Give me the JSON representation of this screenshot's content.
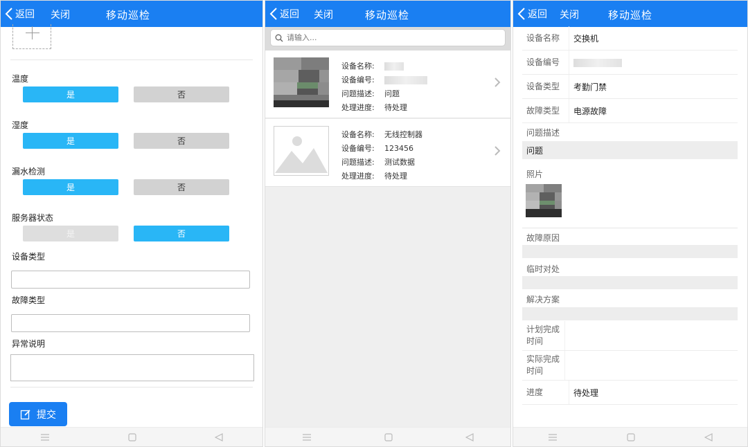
{
  "header": {
    "back_label": "返回",
    "close_label": "关闭",
    "title": "移动巡检"
  },
  "form": {
    "groups": [
      {
        "label": "温度",
        "yes": "是",
        "no": "否",
        "selected": "yes"
      },
      {
        "label": "湿度",
        "yes": "是",
        "no": "否",
        "selected": "yes"
      },
      {
        "label": "漏水检测",
        "yes": "是",
        "no": "否",
        "selected": "yes"
      },
      {
        "label": "服务器状态",
        "yes": "是",
        "no": "否",
        "selected": "no"
      }
    ],
    "device_type_label": "设备类型",
    "device_type_value": "",
    "fault_type_label": "故障类型",
    "fault_type_value": "",
    "exception_label": "异常说明",
    "exception_value": "",
    "submit_label": "提交"
  },
  "list": {
    "search_placeholder": "请输入...",
    "keys": {
      "name": "设备名称:",
      "code": "设备编号:",
      "desc": "问题描述:",
      "progress": "处理进度:"
    },
    "items": [
      {
        "name": "",
        "code": "",
        "desc": "问题",
        "progress": "待处理",
        "image": "pixelated-photo"
      },
      {
        "name": "无线控制器",
        "code": "123456",
        "desc": "测试数据",
        "progress": "待处理",
        "image": "placeholder-image-icon"
      }
    ]
  },
  "detail": {
    "device_name_label": "设备名称",
    "device_name": "交换机",
    "device_code_label": "设备编号",
    "device_code": "",
    "device_type_label": "设备类型",
    "device_type": "考勤门禁",
    "fault_type_label": "故障类型",
    "fault_type": "电源故障",
    "problem_label": "问题描述",
    "problem": "问题",
    "photo_label": "照片",
    "cause_label": "故障原因",
    "cause": "",
    "temp_label": "临时对处",
    "temp": "",
    "solution_label": "解决方案",
    "solution": "",
    "planned_label": "计划完成时间",
    "planned": "",
    "actual_label": "实际完成时间",
    "actual": "",
    "progress_label": "进度",
    "progress": "待处理"
  },
  "colors": {
    "header": "#1a7ff2",
    "selected": "#29b6f6",
    "unselected": "#d2d2d2"
  },
  "icons": {
    "back": "chevron-left-icon",
    "search": "search-icon",
    "edit": "edit-icon",
    "chevron": "chevron-right-icon",
    "nav": [
      "menu-icon",
      "home-square-icon",
      "back-triangle-icon"
    ]
  }
}
